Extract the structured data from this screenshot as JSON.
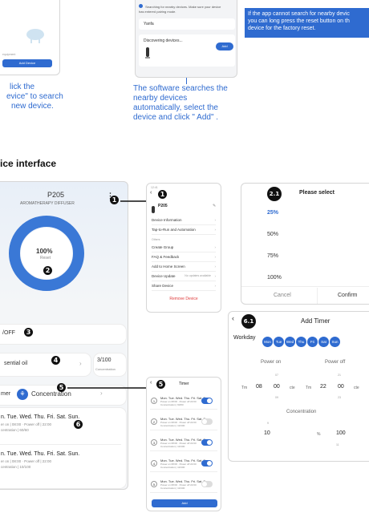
{
  "top_left": {
    "fragment_text": "equipment",
    "add_button": "Add Device",
    "caption_lines": [
      "lick the",
      "evice\" to search",
      "new device."
    ]
  },
  "top_mid": {
    "notice": [
      "Searching for nearby devices. Make sure your device",
      "has entered pairing mode."
    ],
    "wifi_name": "Yanfa",
    "wifi_value": "",
    "discovering": "Discovering devices...",
    "add_button": "Add",
    "caption_lines": [
      "The software searches the",
      "nearby devices",
      "automatically, select the",
      "device and click \" Add\" ."
    ]
  },
  "top_right": {
    "note_lines": [
      "If the app cannot search for nearby devic",
      "you can long press the reset button on th",
      "device for the factory reset."
    ]
  },
  "section_title": "ice interface",
  "main_phone": {
    "device_name": "P205",
    "device_subtitle": "AROMATHERAPY DIFFUSER",
    "ring_value": "100%",
    "ring_label": "Reset",
    "ring_fraction": 1.0,
    "power_label": "/OFF",
    "oil_label": "sential oil",
    "concentration_value": "3/100",
    "concentration_label": "Concentration",
    "timer_label": "mer",
    "concentration_tab": "Concentration",
    "schedules": [
      {
        "days": "n. Tue. Wed. Thu. Fri. Sat. Sun.",
        "times": "er on | 08:00 · Power off | 22:00",
        "conc": "centration | 60/60"
      },
      {
        "days": "n. Tue. Wed. Thu. Fri. Sat. Sun.",
        "times": "er on | 08:00 · Power off | 22:00",
        "conc": "centration | 10/100"
      }
    ]
  },
  "badges": {
    "b1": "1",
    "b2": "2",
    "b3": "3",
    "b4": "4",
    "b5": "5",
    "b6": "6",
    "b21": "2.1",
    "b61": "6.1"
  },
  "menu_phone": {
    "status": "12:41",
    "device_name": "P205",
    "items": [
      {
        "label": "Device Information",
        "value": ""
      },
      {
        "label": "Tap-to-Run and Automation",
        "value": ""
      }
    ],
    "section": "Others",
    "items2": [
      {
        "label": "Create Group",
        "value": ""
      },
      {
        "label": "FAQ & Feedback",
        "value": ""
      },
      {
        "label": "Add to Home Screen",
        "value": ""
      },
      {
        "label": "Device Update",
        "value": "No updates available"
      },
      {
        "label": "Share Device",
        "value": ""
      }
    ],
    "remove": "Remove Device"
  },
  "timer_phone": {
    "title": "Timer",
    "rows": [
      {
        "num": "1",
        "days": "Mon. Tue. Wed. Thu. Fri. Sat. Sun.",
        "line2": "Power on 08:00 · Power off 22:00",
        "line3": "Concentration | 60/60",
        "on": true
      },
      {
        "num": "2",
        "days": "Mon. Tue. Wed. Thu. Fri. Sat. Sun.",
        "line2": "Power on 08:00 · Power off 22:00",
        "line3": "Concentration | 10/100",
        "on": false
      },
      {
        "num": "3",
        "days": "Mon. Tue. Wed. Thu. Fri. Sat. Sun.",
        "line2": "Power on 08:00 · Power off 22:00",
        "line3": "Concentration | 10/100",
        "on": true
      },
      {
        "num": "4",
        "days": "Mon. Tue. Wed. Thu. Fri. Sat. Sun.",
        "line2": "Power on 08:00 · Power off 22:00",
        "line3": "Concentration | 10/100",
        "on": true
      },
      {
        "num": "5",
        "days": "Mon. Tue. Wed. Thu. Fri. Sat. Sun.",
        "line2": "Power on 08:00 · Power off 22:00",
        "line3": "Concentration | 10/100",
        "on": false
      }
    ],
    "add_button": "Add"
  },
  "select_phone": {
    "title": "Please select",
    "options": [
      "25%",
      "50%",
      "75%",
      "100%"
    ],
    "cancel": "Cancel",
    "confirm": "Confirm"
  },
  "add_timer_phone": {
    "title": "Add Timer",
    "workday": "Workday",
    "days": [
      "Mon",
      "Tue",
      "Wed",
      "Thu",
      "Fri",
      "Sat",
      "Sun"
    ],
    "power_on": "Power on",
    "power_off": "Power off",
    "on_prev": "07",
    "on_hour": "08",
    "on_min": "00",
    "on_next": "09",
    "off_prev": "21",
    "off_hour": "22",
    "off_min": "00",
    "off_next": "23",
    "tm": "Tm",
    "unit_short": "cte",
    "concentration": "Concentration",
    "conc_prev": "9",
    "conc_value": "10",
    "conc_pct": "%",
    "conc_max": "100",
    "conc_next": "11"
  },
  "colors": {
    "accent": "#2f6bd0",
    "ring": "#3a78d6"
  }
}
